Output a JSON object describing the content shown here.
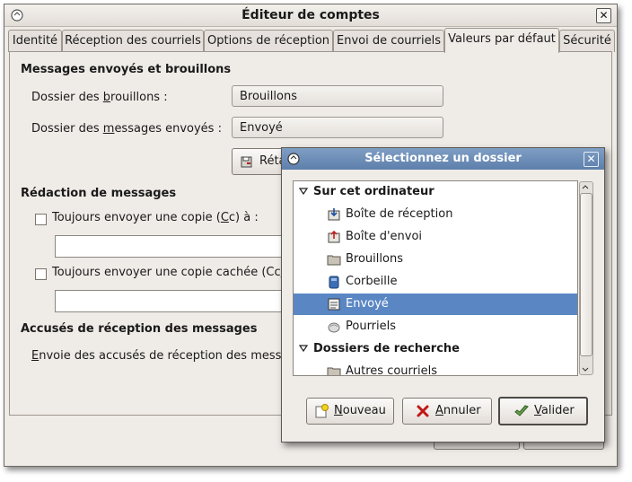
{
  "window": {
    "title": "Éditeur de comptes",
    "close_glyph": "✕"
  },
  "tabs": [
    {
      "label": "Identité"
    },
    {
      "label": "Réception des courriels"
    },
    {
      "label": "Options de réception"
    },
    {
      "label": "Envoi de courriels"
    },
    {
      "label": "Valeurs par défaut",
      "active": true
    },
    {
      "label": "Sécurité"
    }
  ],
  "messages_section": {
    "heading": "Messages envoyés et brouillons",
    "drafts_label_pre": "Dossier des ",
    "drafts_label_mnemonic": "b",
    "drafts_label_post": "rouillons :",
    "drafts_value": "Brouillons",
    "sent_label_pre": "Dossier des ",
    "sent_label_mnemonic": "m",
    "sent_label_post": "essages envoyés :",
    "sent_value": "Envoyé",
    "restore_button": "Réta"
  },
  "composition_section": {
    "heading": "Rédaction de messages",
    "cc_label_pre": "Toujours envoyer une copie (",
    "cc_mnemonic": "C",
    "cc_label_post": "c) à :",
    "cc_value": "",
    "bcc_label_pre": "Toujours envoyer une copie cachée (Cc",
    "bcc_mnemonic": "i",
    "bcc_label_post": ")",
    "bcc_value": ""
  },
  "receipts_section": {
    "heading": "Accusés de réception des messages",
    "label_mnemonic": "E",
    "label_post": "nvoie des accusés de réception des messa"
  },
  "folder_dialog": {
    "title": "Sélectionnez un dossier",
    "close_glyph": "✕",
    "tree": [
      {
        "type": "group",
        "label": "Sur cet ordinateur",
        "icon": "expander-down-icon"
      },
      {
        "type": "item",
        "label": "Boîte de réception",
        "icon": "inbox-icon"
      },
      {
        "type": "item",
        "label": "Boîte d'envoi",
        "icon": "outbox-icon"
      },
      {
        "type": "item",
        "label": "Brouillons",
        "icon": "folder-icon"
      },
      {
        "type": "item",
        "label": "Corbeille",
        "icon": "trash-icon"
      },
      {
        "type": "item",
        "label": "Envoyé",
        "icon": "sent-icon",
        "selected": true
      },
      {
        "type": "item",
        "label": "Pourriels",
        "icon": "junk-icon"
      },
      {
        "type": "group",
        "label": "Dossiers de recherche",
        "icon": "expander-down-icon"
      },
      {
        "type": "item",
        "label": "Autres courriels",
        "icon": "folder-icon"
      }
    ],
    "buttons": {
      "new_mnemonic": "N",
      "new_rest": "ouveau",
      "cancel_mnemonic": "A",
      "cancel_rest": "nnuler",
      "ok_mnemonic": "V",
      "ok_rest": "alider"
    }
  },
  "colors": {
    "selection": "#5a87c4",
    "dialog_title": "#6a8ab6",
    "window_bg": "#efebe7"
  }
}
